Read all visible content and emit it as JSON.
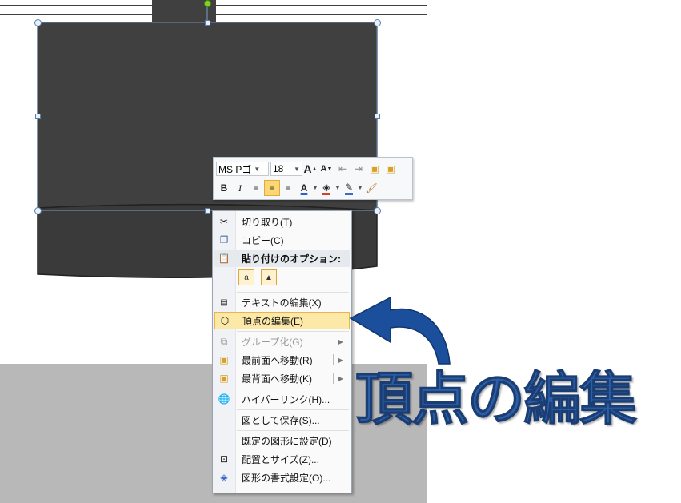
{
  "mini_toolbar": {
    "font_name": "MS Pゴ",
    "font_size": "18",
    "grow_font_label": "A",
    "shrink_font_label": "A",
    "bold_label": "B",
    "italic_label": "I",
    "font_color_label": "A"
  },
  "context_menu": {
    "items": [
      {
        "label": "切り取り(T)",
        "icon": "scissors-icon",
        "enabled": true
      },
      {
        "label": "コピー(C)",
        "icon": "copy-icon",
        "enabled": true
      },
      {
        "label": "貼り付けのオプション:",
        "icon": "clipboard-icon",
        "enabled": true
      },
      {
        "label": "テキストの編集(X)",
        "icon": "text-box-icon",
        "enabled": true
      },
      {
        "label": "頂点の編集(E)",
        "icon": "edit-points-icon",
        "enabled": true,
        "highlighted": true
      },
      {
        "label": "グループ化(G)",
        "icon": "group-icon",
        "enabled": false
      },
      {
        "label": "最前面へ移動(R)",
        "icon": "bring-to-front-icon",
        "enabled": true
      },
      {
        "label": "最背面へ移動(K)",
        "icon": "send-to-back-icon",
        "enabled": true
      },
      {
        "label": "ハイパーリンク(H)...",
        "icon": "hyperlink-icon",
        "enabled": true
      },
      {
        "label": "図として保存(S)...",
        "icon": "",
        "enabled": true
      },
      {
        "label": "既定の図形に設定(D)",
        "icon": "",
        "enabled": true
      },
      {
        "label": "配置とサイズ(Z)...",
        "icon": "size-position-icon",
        "enabled": true
      },
      {
        "label": "図形の書式設定(O)...",
        "icon": "format-shape-icon",
        "enabled": true
      }
    ]
  },
  "annotation": {
    "text": "頂点の編集",
    "color": "#2b5fa8",
    "arrow_color": "#1b4f9c"
  },
  "colors": {
    "shape_fill": "#404040",
    "highlight": "#fde9a7",
    "canvas_gray": "#b8b8b8"
  }
}
